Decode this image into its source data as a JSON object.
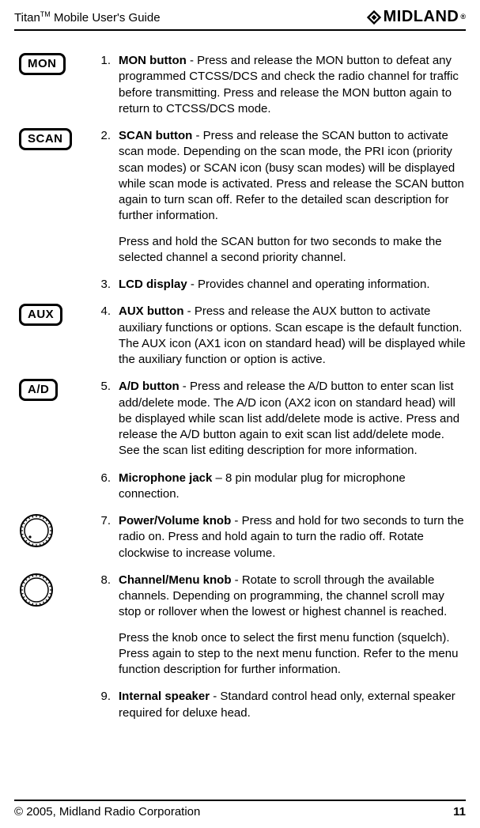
{
  "header": {
    "title_prefix": "Titan",
    "title_tm": "TM",
    "title_suffix": " Mobile User's Guide",
    "logo_text": "MIDLAND",
    "logo_reg": "®"
  },
  "items": [
    {
      "icon_type": "button",
      "icon_label": "MON",
      "num": "1.",
      "term": "MON button",
      "body": " - Press and release the MON button to defeat any programmed CTCSS/DCS and check the radio channel for traffic before transmitting. Press and release the MON button again to return to CTCSS/DCS mode.",
      "extra": ""
    },
    {
      "icon_type": "button",
      "icon_label": "SCAN",
      "num": "2.",
      "term": "SCAN button",
      "body": " - Press and release the SCAN button to activate scan mode. Depending on the scan mode, the PRI icon (priority scan modes) or SCAN icon (busy scan modes) will be displayed while scan mode is activated. Press and release the SCAN button again to turn scan off. Refer to the detailed scan description for further information.",
      "extra": "Press and hold the SCAN button for two seconds to make the selected channel a second priority channel."
    },
    {
      "icon_type": "none",
      "icon_label": "",
      "num": "3.",
      "term": "LCD display",
      "body": " - Provides channel and operating information.",
      "extra": ""
    },
    {
      "icon_type": "button",
      "icon_label": "AUX",
      "num": "4.",
      "term": "AUX button",
      "body": " - Press and release the AUX button to activate auxiliary functions or options. Scan escape is the default function. The AUX icon (AX1 icon on standard head) will be displayed while the auxiliary function or option is active.",
      "extra": ""
    },
    {
      "icon_type": "button",
      "icon_label": "A/D",
      "num": "5.",
      "term": "A/D button",
      "body": " - Press and release the A/D button to enter scan list add/delete mode. The A/D icon (AX2 icon on standard head) will be displayed while scan list add/delete mode is active. Press and release the A/D button again to exit scan list add/delete mode. See the scan list editing description for more information.",
      "extra": ""
    },
    {
      "icon_type": "none",
      "icon_label": "",
      "num": "6.",
      "term": "Microphone jack",
      "body": " – 8 pin modular plug for microphone connection.",
      "extra": ""
    },
    {
      "icon_type": "knob-dot",
      "icon_label": "",
      "num": "7.",
      "term": "Power/Volume knob",
      "body": " - Press and hold for two seconds to turn the radio on. Press and hold again to turn the radio off. Rotate clockwise to increase volume.",
      "extra": ""
    },
    {
      "icon_type": "knob",
      "icon_label": "",
      "num": "8.",
      "term": "Channel/Menu knob",
      "body": " - Rotate to scroll through the available channels. Depending on programming, the channel scroll may stop or rollover when the lowest or highest channel is reached.",
      "extra": "Press the knob once to select the first menu function (squelch). Press again to step to the next menu function. Refer to the menu function description for further information."
    },
    {
      "icon_type": "none",
      "icon_label": "",
      "num": "9.",
      "term": "Internal speaker",
      "body": " - Standard control head only, external speaker required for deluxe head.",
      "extra": ""
    }
  ],
  "footer": {
    "copyright": "© 2005, Midland Radio Corporation",
    "page": "11"
  }
}
